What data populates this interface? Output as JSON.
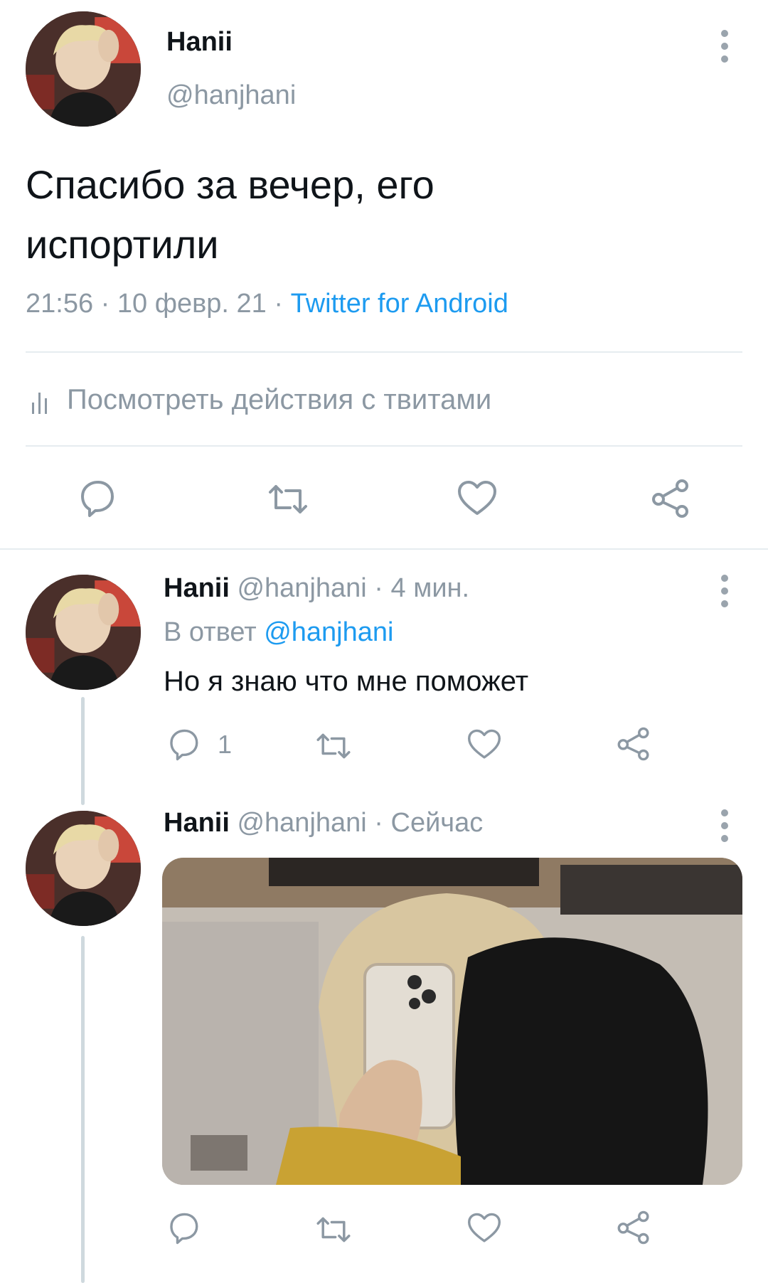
{
  "main_tweet": {
    "display_name": "Hanii",
    "handle": "@hanjhani",
    "text_line1": "Спасибо за вечер, его",
    "text_line2": "испортили",
    "time": "21:56",
    "sep1": " · ",
    "date": "10 февр. 21",
    "sep2": " · ",
    "source": "Twitter for Android",
    "activity_label": "Посмотреть действия с твитами",
    "actions": {
      "reply_icon": "reply-icon",
      "retweet_icon": "retweet-icon",
      "like_icon": "heart-icon",
      "share_icon": "share-icon"
    }
  },
  "reply1": {
    "display_name": "Hanii",
    "handle": "@hanjhani",
    "meta": " · 4 мин.",
    "reply_to_prefix": "В ответ ",
    "reply_to_handle": "@hanjhani",
    "text": "Но я знаю что мне поможет",
    "reply_count": "1"
  },
  "reply2": {
    "display_name": "Hanii",
    "handle": "@hanjhani",
    "meta": " · Сейчас"
  },
  "colors": {
    "accent": "#1d9bf0",
    "muted": "#8c98a3",
    "divider": "#e6ecf0",
    "thread_line": "#cfd9de"
  }
}
